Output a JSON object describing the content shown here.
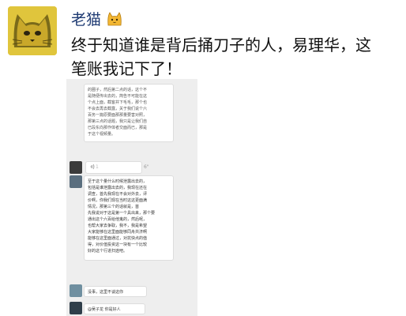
{
  "post": {
    "username": "老猫",
    "avatar_icon": "cat-avatar-icon",
    "emoji_icon": "cat-face-emoji-icon",
    "text_line1": "终于知道谁是背后捅刀子的人，易理华，这",
    "text_line2": "笔账我记下了！"
  },
  "screenshot": {
    "bubble1_lines": [
      "的圈子，然后第二点的话，这个不",
      "是随便传出去的，简告不可能在这",
      "个点上面，截客并下毛毛，那个也",
      "不会去再去截露，关于我们说个六",
      "百务一篇原要面那那量要害对照，",
      "那第三点的话题，我只是让我们自",
      "已段东向那作体者交面而已，那是",
      "于这个视频量。"
    ],
    "voice_duration": "6\"",
    "voice_mark": "1",
    "bubble2_lines": [
      "至于这个量什么时候泄露出去的，",
      "包括是谁泄露出去的，我现在还在",
      "调查，首先我现在不会对外去，评",
      "价啊，你我们现在当时这这更面满",
      "情况，那第三个的话就是，首",
      "先我说对于这是第一个具出来，那个要",
      "通出这个六百给他鬼的，然后呢，",
      "也帮大家去争取，我不，我是希望",
      "大家能够在这里面能够同舟共济啊",
      "能够在这里面通过，对抗快点的值",
      "得，对价值投资这一块有一个比较",
      "好的这个行进扫途吧。"
    ],
    "bubble3_text": "没事，这里不谈这你",
    "bubble4_text": "@吴子龙 你是好人"
  },
  "colors": {
    "username": "#1f3b73",
    "avatar_bg": "#e0c53c",
    "screenshot_bg": "#eeeeee"
  }
}
